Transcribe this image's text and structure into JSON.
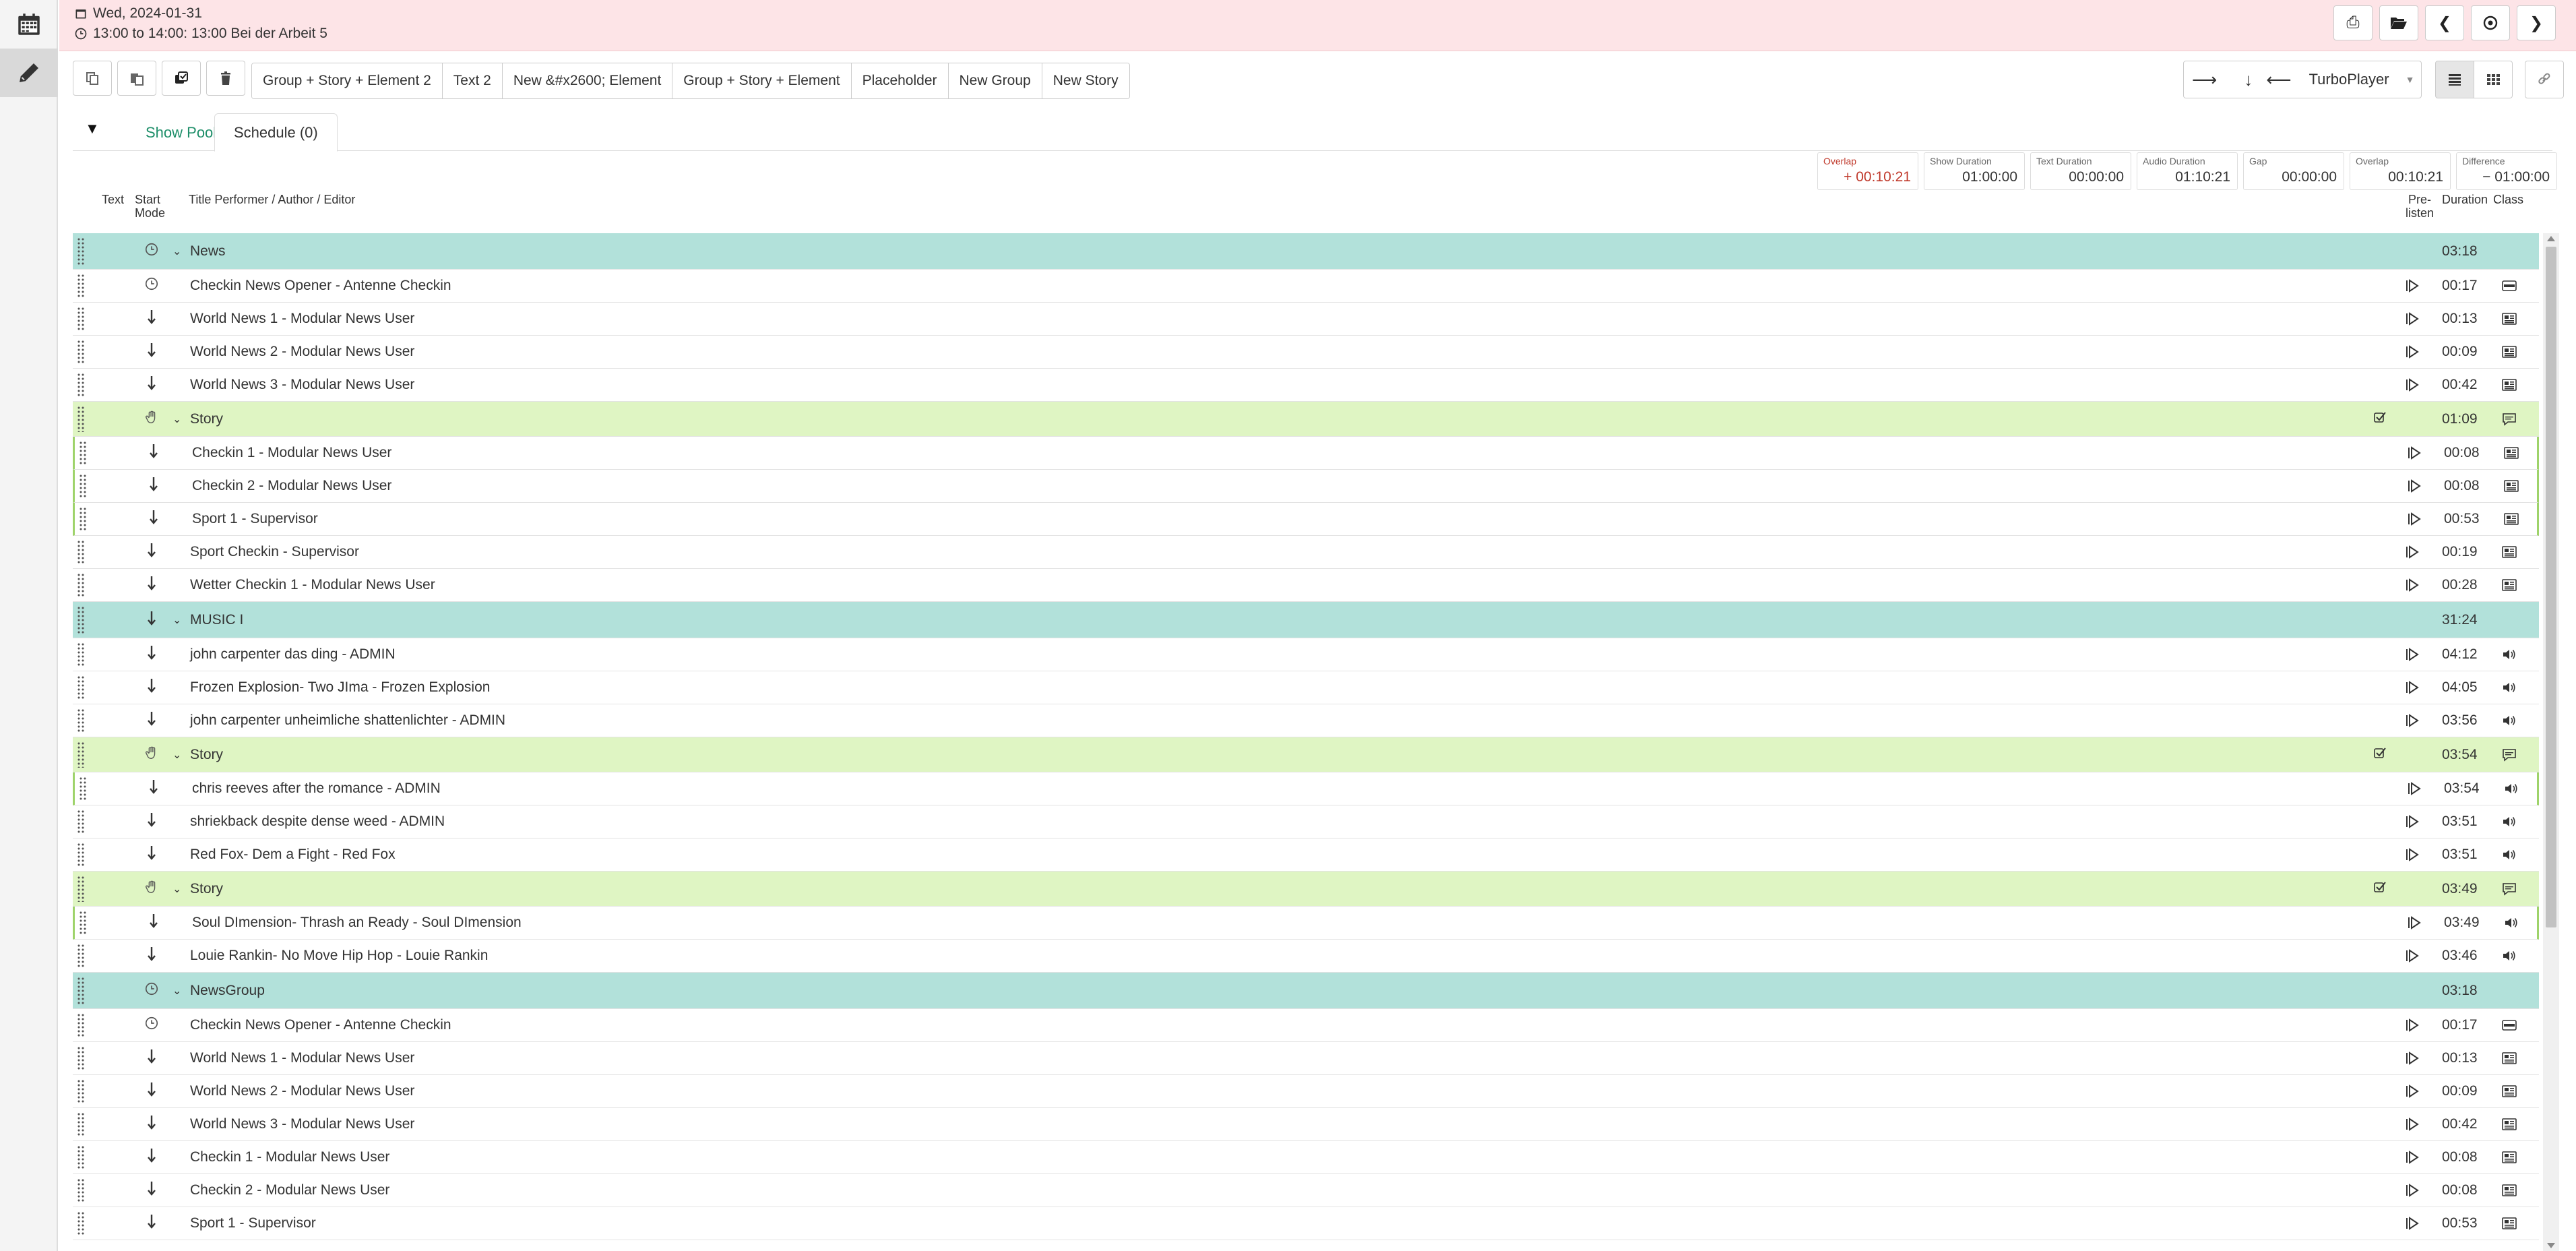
{
  "header": {
    "date": "Wed, 2024-01-31",
    "slot": "13:00 to 14:00: 13:00 Bei der Arbeit 5"
  },
  "toolbar": {
    "templates": [
      "Group + Story + Element 2",
      "Text 2",
      "New &#x2600; Element",
      "Group + Story + Element",
      "Placeholder",
      "New Group",
      "New Story"
    ],
    "player_name": "TurboPlayer"
  },
  "tabs": {
    "pool": "Show Pool",
    "schedule": "Schedule (0)"
  },
  "summary": [
    {
      "label": "Overlap",
      "value": "+ 00:10:21"
    },
    {
      "label": "Show Duration",
      "value": "01:00:00"
    },
    {
      "label": "Text Duration",
      "value": "00:00:00"
    },
    {
      "label": "Audio Duration",
      "value": "01:10:21"
    },
    {
      "label": "Gap",
      "value": "00:00:00"
    },
    {
      "label": "Overlap",
      "value": "00:10:21"
    },
    {
      "label": "Difference",
      "value": "− 01:00:00"
    }
  ],
  "columns": {
    "text": "Text",
    "start": "Start",
    "mode": "Mode",
    "title": "Title Performer / Author / Editor",
    "pre": "Pre-",
    "listen": "listen",
    "duration": "Duration",
    "class": "Class"
  },
  "rows": [
    {
      "kind": "group",
      "mode": "clock",
      "title": "News",
      "duration": "03:18"
    },
    {
      "kind": "item",
      "mode": "clock",
      "title": "Checkin News Opener - Antenne Checkin",
      "duration": "00:17",
      "cls": "jingle"
    },
    {
      "kind": "item",
      "mode": "arrow",
      "title": "World News 1 - Modular News User",
      "duration": "00:13",
      "cls": "news"
    },
    {
      "kind": "item",
      "mode": "arrow",
      "title": "World News 2 - Modular News User",
      "duration": "00:09",
      "cls": "news"
    },
    {
      "kind": "item",
      "mode": "arrow",
      "title": "World News 3 - Modular News User",
      "duration": "00:42",
      "cls": "news"
    },
    {
      "kind": "story",
      "mode": "hand",
      "title": "Story",
      "duration": "01:09"
    },
    {
      "kind": "item",
      "mode": "arrow",
      "title": "Checkin 1 - Modular News User",
      "duration": "00:08",
      "cls": "news",
      "inStory": true
    },
    {
      "kind": "item",
      "mode": "arrow",
      "title": "Checkin 2 - Modular News User",
      "duration": "00:08",
      "cls": "news",
      "inStory": true
    },
    {
      "kind": "item",
      "mode": "arrow",
      "title": "Sport 1 - Supervisor",
      "duration": "00:53",
      "cls": "news",
      "inStory": true
    },
    {
      "kind": "item",
      "mode": "arrow",
      "title": "Sport Checkin - Supervisor",
      "duration": "00:19",
      "cls": "news"
    },
    {
      "kind": "item",
      "mode": "arrow",
      "title": "Wetter Checkin 1 - Modular News User",
      "duration": "00:28",
      "cls": "news"
    },
    {
      "kind": "group",
      "mode": "arrow",
      "title": "MUSIC I",
      "duration": "31:24"
    },
    {
      "kind": "item",
      "mode": "arrow",
      "title": "john carpenter das ding - ADMIN",
      "duration": "04:12",
      "cls": "audio"
    },
    {
      "kind": "item",
      "mode": "arrow",
      "title": "Frozen Explosion- Two JIma - Frozen Explosion",
      "duration": "04:05",
      "cls": "audio"
    },
    {
      "kind": "item",
      "mode": "arrow",
      "title": "john carpenter unheimliche shattenlichter - ADMIN",
      "duration": "03:56",
      "cls": "audio"
    },
    {
      "kind": "story",
      "mode": "hand",
      "title": "Story",
      "duration": "03:54"
    },
    {
      "kind": "item",
      "mode": "arrow",
      "title": "chris reeves after the romance - ADMIN",
      "duration": "03:54",
      "cls": "audio",
      "inStory": true
    },
    {
      "kind": "item",
      "mode": "arrow",
      "title": "shriekback despite dense weed - ADMIN",
      "duration": "03:51",
      "cls": "audio"
    },
    {
      "kind": "item",
      "mode": "arrow",
      "title": "Red Fox- Dem a Fight - Red Fox",
      "duration": "03:51",
      "cls": "audio"
    },
    {
      "kind": "story",
      "mode": "hand",
      "title": "Story",
      "duration": "03:49"
    },
    {
      "kind": "item",
      "mode": "arrow",
      "title": "Soul DImension- Thrash an Ready - Soul DImension",
      "duration": "03:49",
      "cls": "audio",
      "inStory": true
    },
    {
      "kind": "item",
      "mode": "arrow",
      "title": "Louie Rankin- No Move Hip Hop - Louie Rankin",
      "duration": "03:46",
      "cls": "audio"
    },
    {
      "kind": "group",
      "mode": "clock",
      "title": "NewsGroup",
      "duration": "03:18"
    },
    {
      "kind": "item",
      "mode": "clock",
      "title": "Checkin News Opener - Antenne Checkin",
      "duration": "00:17",
      "cls": "jingle"
    },
    {
      "kind": "item",
      "mode": "arrow",
      "title": "World News 1 - Modular News User",
      "duration": "00:13",
      "cls": "news"
    },
    {
      "kind": "item",
      "mode": "arrow",
      "title": "World News 2 - Modular News User",
      "duration": "00:09",
      "cls": "news"
    },
    {
      "kind": "item",
      "mode": "arrow",
      "title": "World News 3 - Modular News User",
      "duration": "00:42",
      "cls": "news"
    },
    {
      "kind": "item",
      "mode": "arrow",
      "title": "Checkin 1 - Modular News User",
      "duration": "00:08",
      "cls": "news"
    },
    {
      "kind": "item",
      "mode": "arrow",
      "title": "Checkin 2 - Modular News User",
      "duration": "00:08",
      "cls": "news"
    },
    {
      "kind": "item",
      "mode": "arrow",
      "title": "Sport 1 - Supervisor",
      "duration": "00:53",
      "cls": "news"
    }
  ]
}
